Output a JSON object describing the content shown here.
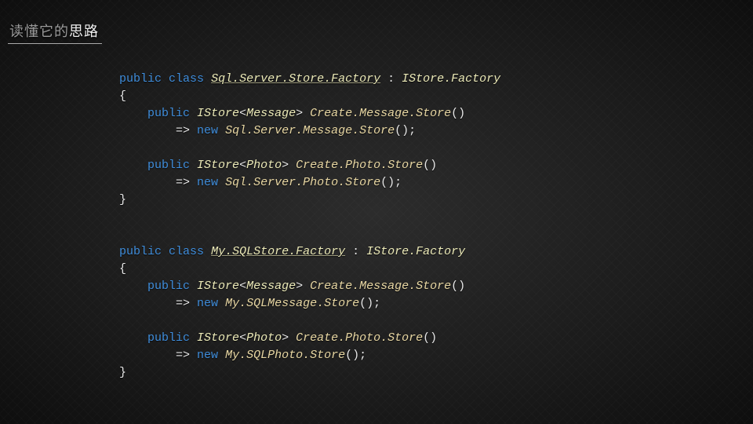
{
  "title": {
    "gray": "读懂它的",
    "white": "思路"
  },
  "tokens": {
    "kw_public": "public",
    "kw_class": "class",
    "kw_new": "new",
    "op_colon": " : ",
    "op_arrow": "=>",
    "brace_open": "{",
    "brace_close": "}",
    "parens": "()",
    "semi": ";",
    "lt": "<",
    "gt": ">"
  },
  "types": {
    "istore_factory": "IStore.Factory",
    "istore": "IStore",
    "message": "Message",
    "photo": "Photo"
  },
  "class1": {
    "name": "Sql.Server.Store.Factory",
    "m1": {
      "method": "Create.Message.Store",
      "impl": "Sql.Server.Message.Store"
    },
    "m2": {
      "method": "Create.Photo.Store",
      "impl": "Sql.Server.Photo.Store"
    }
  },
  "class2": {
    "name": "My.SQLStore.Factory",
    "m1": {
      "method": "Create.Message.Store",
      "impl": "My.SQLMessage.Store"
    },
    "m2": {
      "method": "Create.Photo.Store",
      "impl": "My.SQLPhoto.Store"
    }
  }
}
